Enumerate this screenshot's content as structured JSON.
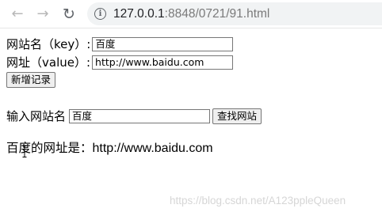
{
  "browser": {
    "url_host": "127.0.0.1",
    "url_path": ":8848/0721/91.html"
  },
  "form_add": {
    "key_label": "网站名（key）:",
    "key_value": "百度",
    "value_label": "网址（value）:",
    "value_value": "http://www.baidu.com",
    "add_button": "新增记录"
  },
  "form_search": {
    "label": "输入网站名",
    "value": "百度",
    "button": "查找网站"
  },
  "result": {
    "prefix": "百度的网址是：",
    "url": "http://www.baidu.com"
  },
  "watermark": "https://blog.csdn.net/A123ppleQueen"
}
